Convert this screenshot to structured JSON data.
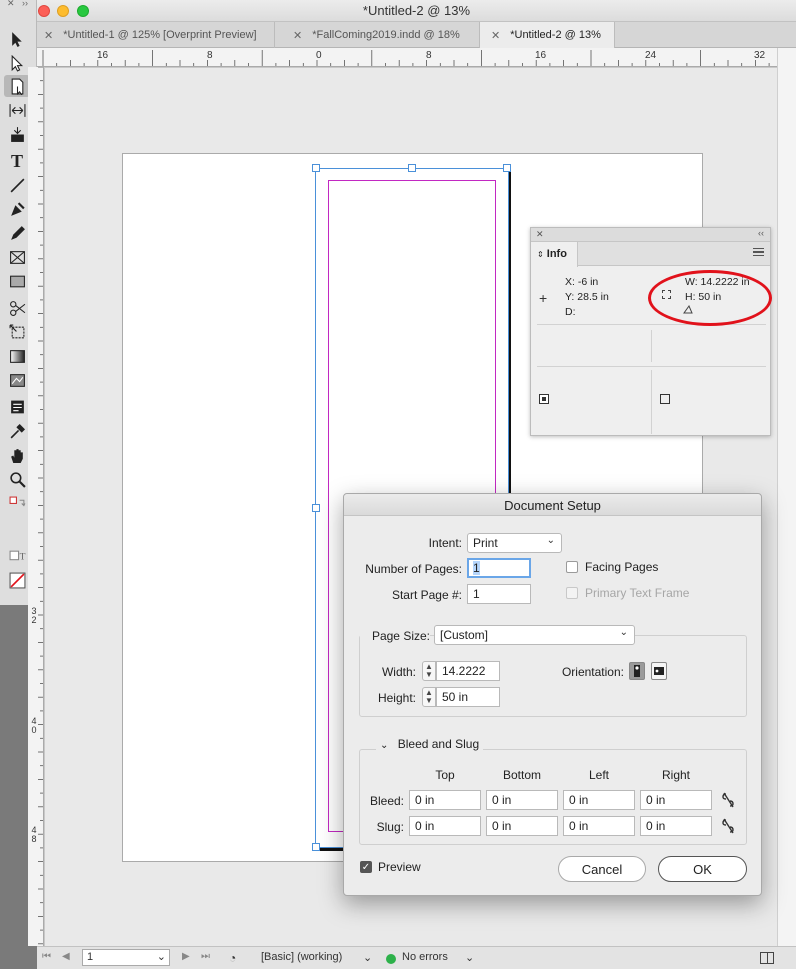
{
  "window": {
    "title": "*Untitled-2 @ 13%",
    "tabs": [
      {
        "label": "*Untitled-1 @ 125% [Overprint Preview]"
      },
      {
        "label": "*FallComing2019.indd @ 18%"
      },
      {
        "label": "*Untitled-2 @ 13%"
      }
    ]
  },
  "toolbar": {
    "collapse": "››",
    "tools": [
      "selection-tool-icon",
      "direct-selection-tool-icon",
      "page-tool-icon",
      "gap-tool-icon",
      "content-collector-icon",
      "type-tool-icon",
      "line-tool-icon",
      "pen-tool-icon",
      "pencil-tool-icon",
      "rectangle-frame-tool-icon",
      "rectangle-tool-icon",
      "scissors-tool-icon",
      "free-transform-tool-icon",
      "gradient-swatch-tool-icon",
      "gradient-feather-tool-icon",
      "note-tool-icon",
      "eyedropper-tool-icon",
      "hand-tool-icon",
      "zoom-tool-icon"
    ],
    "type_glyph": "T"
  },
  "rulers": {
    "horizontal": [
      "16",
      "8",
      "0",
      "8",
      "16",
      "24",
      "32"
    ],
    "vertical": [
      "3 2",
      "4 0",
      "4 8"
    ]
  },
  "info_panel": {
    "tab": "Info",
    "close": "✕",
    "collapse": "‹‹",
    "x": "X: -6 in",
    "y": "Y: 28.5 in",
    "d": "D:",
    "w": "W: 14.2222 in",
    "h": "H: 50 in"
  },
  "dialog": {
    "title": "Document Setup",
    "intent_label": "Intent:",
    "intent_value": "Print",
    "pages_label": "Number of Pages:",
    "pages_value": "1",
    "start_label": "Start Page #:",
    "start_value": "1",
    "facing_label": "Facing Pages",
    "primary_label": "Primary Text Frame",
    "page_size_label": "Page Size:",
    "page_size_value": "[Custom]",
    "width_label": "Width:",
    "width_value": "14.2222",
    "height_label": "Height:",
    "height_value": "50 in",
    "orientation_label": "Orientation:",
    "bleed_slug_label": "Bleed and Slug",
    "columns": [
      "Top",
      "Bottom",
      "Left",
      "Right"
    ],
    "bleed_label": "Bleed:",
    "bleed_values": [
      "0 in",
      "0 in",
      "0 in",
      "0 in"
    ],
    "slug_label": "Slug:",
    "slug_values": [
      "0 in",
      "0 in",
      "0 in",
      "0 in"
    ],
    "preview_label": "Preview",
    "cancel_label": "Cancel",
    "ok_label": "OK"
  },
  "statusbar": {
    "page": "1",
    "style": "[Basic] (working)",
    "errors": "No errors"
  },
  "colors": {
    "accent": "#4a90d9",
    "margin": "#c228c2",
    "highlight": "#e1121b",
    "ok_status": "#2db14a"
  }
}
